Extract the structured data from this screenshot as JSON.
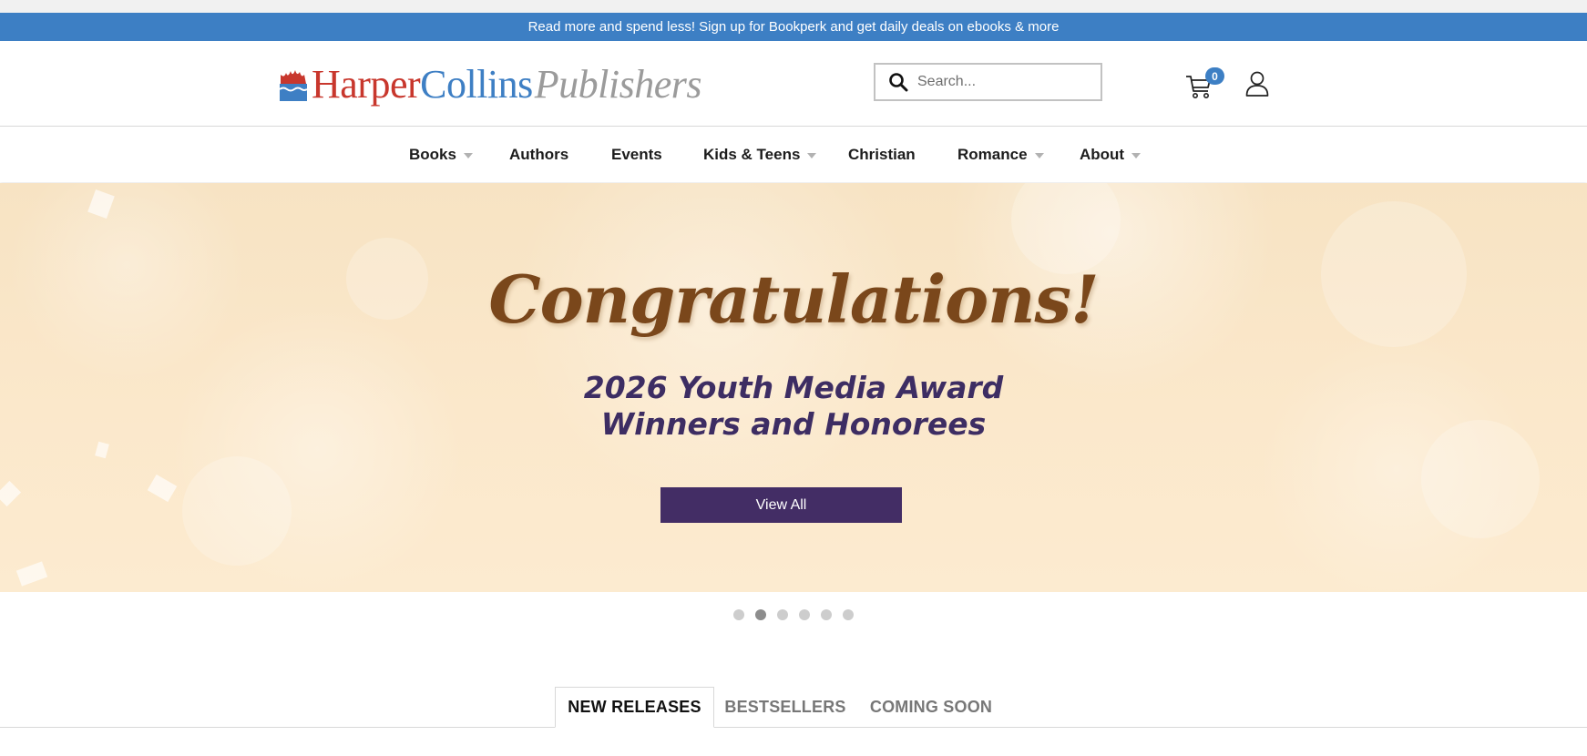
{
  "promo": {
    "text": "Read more and spend less! Sign up for Bookperk and get daily deals on ebooks & more"
  },
  "header": {
    "logo": {
      "part1": "Harper",
      "part2": "Collins",
      "part3": "Publishers"
    },
    "search": {
      "placeholder": "Search..."
    },
    "cart": {
      "count": "0"
    }
  },
  "nav": {
    "items": [
      {
        "label": "Books",
        "has_dropdown": true
      },
      {
        "label": "Authors",
        "has_dropdown": false
      },
      {
        "label": "Events",
        "has_dropdown": false
      },
      {
        "label": "Kids & Teens",
        "has_dropdown": true
      },
      {
        "label": "Christian",
        "has_dropdown": false
      },
      {
        "label": "Romance",
        "has_dropdown": true
      },
      {
        "label": "About",
        "has_dropdown": true
      }
    ]
  },
  "hero": {
    "title": "Congratulations!",
    "subtitle_line1": "2026 Youth Media Award",
    "subtitle_line2": "Winners and Honorees",
    "button_label": "View All"
  },
  "carousel": {
    "slide_count": 6,
    "active_index": 1
  },
  "tabs": [
    {
      "label": "NEW RELEASES",
      "active": true
    },
    {
      "label": "BESTSELLERS",
      "active": false
    },
    {
      "label": "COMING SOON",
      "active": false
    }
  ],
  "colors": {
    "promo_bar": "#3d7fc4",
    "brand_red": "#c8372d",
    "brand_blue": "#3e7fc4",
    "hero_button": "#432d65",
    "hero_title": "#7a471b",
    "hero_subtitle": "#3d2d63"
  },
  "icons": {
    "logo_mark": "flame-ship-logo-icon",
    "search": "search-icon",
    "cart": "cart-icon",
    "account": "user-icon",
    "dropdown": "caret-down-icon"
  }
}
